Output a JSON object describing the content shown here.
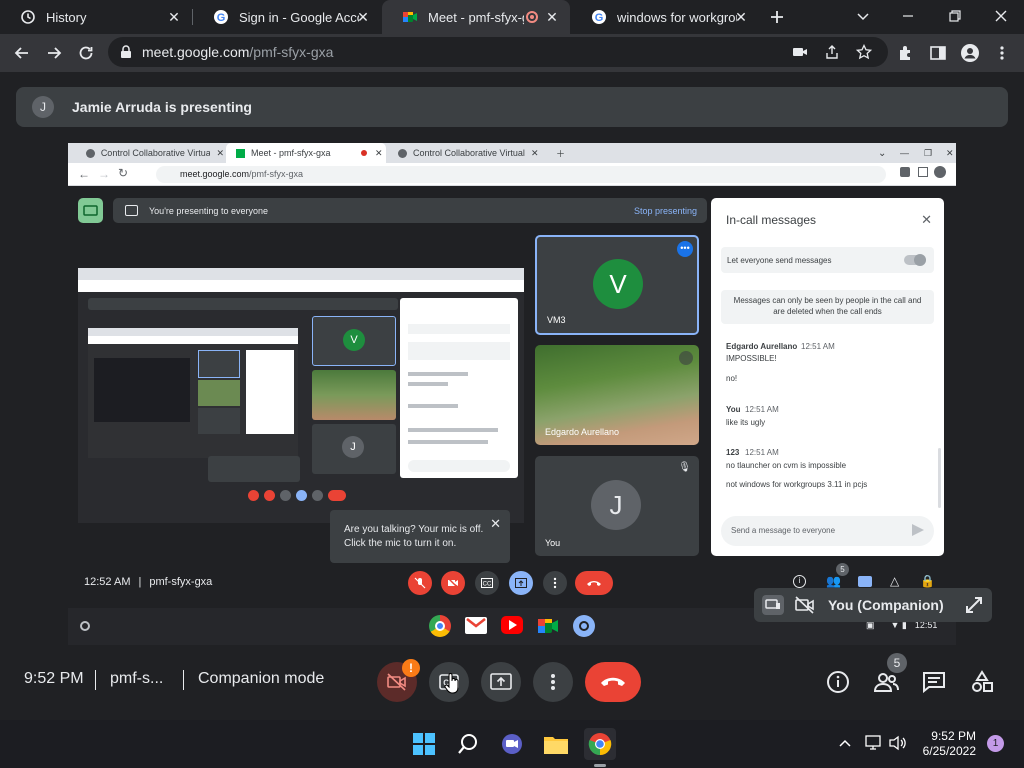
{
  "browser": {
    "tabs": [
      {
        "title": "History",
        "icon": "history-icon"
      },
      {
        "title": "Sign in - Google Accou",
        "icon": "google-icon"
      },
      {
        "title": "Meet - pmf-sfyx-g",
        "icon": "meet-icon"
      },
      {
        "title": "windows for workgroup",
        "icon": "google-icon"
      }
    ],
    "url_host": "meet.google.com",
    "url_path": "/pmf-sfyx-gxa"
  },
  "meet": {
    "presenter_initial": "J",
    "presenting_text": "Jamie Arruda is presenting",
    "time": "9:52 PM",
    "meeting_code": "pmf-s...",
    "mode": "Companion mode",
    "people_count": "5",
    "companion_label": "You (Companion)",
    "warning_badge": "!"
  },
  "shared": {
    "tabs": [
      "Control Collaborative Virtual M",
      "Meet - pmf-sfyx-gxa",
      "Control Collaborative Virtual M"
    ],
    "url_host": "meet.google.com",
    "url_path": "/pmf-sfyx-gxa",
    "presenting_msg": "You're presenting to everyone",
    "stop_presenting": "Stop presenting",
    "tiles": [
      {
        "initial": "V",
        "name": "VM3"
      },
      {
        "name": "Edgardo Aurellano"
      },
      {
        "initial": "J",
        "name": "You"
      }
    ],
    "tooltip_line1": "Are you talking? Your mic is off.",
    "tooltip_line2": "Click the mic to turn it on.",
    "time": "12:52 AM",
    "code": "pmf-sfyx-gxa",
    "people_count": "5",
    "clock_small": "12:51",
    "chat": {
      "title": "In-call messages",
      "toggle_label": "Let everyone send messages",
      "notice_line1": "Messages can only be seen by people in the call and",
      "notice_line2": "are deleted when the call ends",
      "messages": [
        {
          "author": "Edgardo Aurellano",
          "time": "12:51 AM",
          "lines": [
            "IMPOSSIBLE!",
            "no!"
          ]
        },
        {
          "author": "You",
          "time": "12:51 AM",
          "lines": [
            "like its ugly"
          ]
        },
        {
          "author": "123",
          "time": "12:51 AM",
          "lines": [
            "no tlauncher on cvm is impossible",
            "not windows for workgroups 3.11 in pcjs"
          ]
        }
      ],
      "input_placeholder": "Send a message to everyone"
    }
  },
  "taskbar": {
    "time": "9:52 PM",
    "date": "6/25/2022",
    "notif_count": "1"
  },
  "colors": {
    "meet_bg": "#202124",
    "end_call_red": "#ea4335",
    "green_avatar": "#1e8e3e",
    "blue_accent": "#8ab4f8"
  }
}
